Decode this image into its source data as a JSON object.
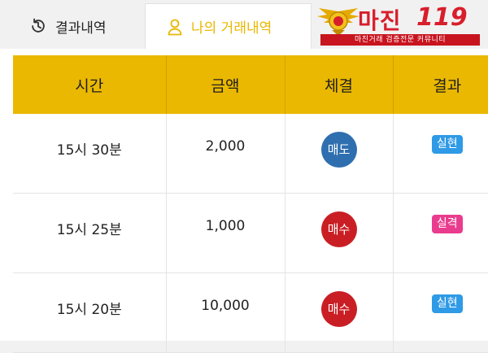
{
  "tabs": [
    {
      "label": "결과내역",
      "icon": "history-icon"
    },
    {
      "label": "나의 거래내역",
      "icon": "user-icon"
    }
  ],
  "logo": {
    "main": "마진",
    "number": "119",
    "tagline": "마진거래 검증전문 커뮤니티"
  },
  "table": {
    "headers": [
      "시간",
      "금액",
      "체결",
      "결과"
    ],
    "rows": [
      {
        "time": "15시 30분",
        "amount": "2,000",
        "trade": "매도",
        "result": "실현"
      },
      {
        "time": "15시 25분",
        "amount": "1,000",
        "trade": "매수",
        "result": "실격"
      },
      {
        "time": "15시 20분",
        "amount": "10,000",
        "trade": "매수",
        "result": "실현"
      }
    ]
  },
  "colors": {
    "accent": "#eab800",
    "sell": "#2f6fb0",
    "buy": "#c91f24",
    "hit": "#2f9ae6",
    "miss": "#ea3c8e",
    "logo": "#d81e2c"
  }
}
